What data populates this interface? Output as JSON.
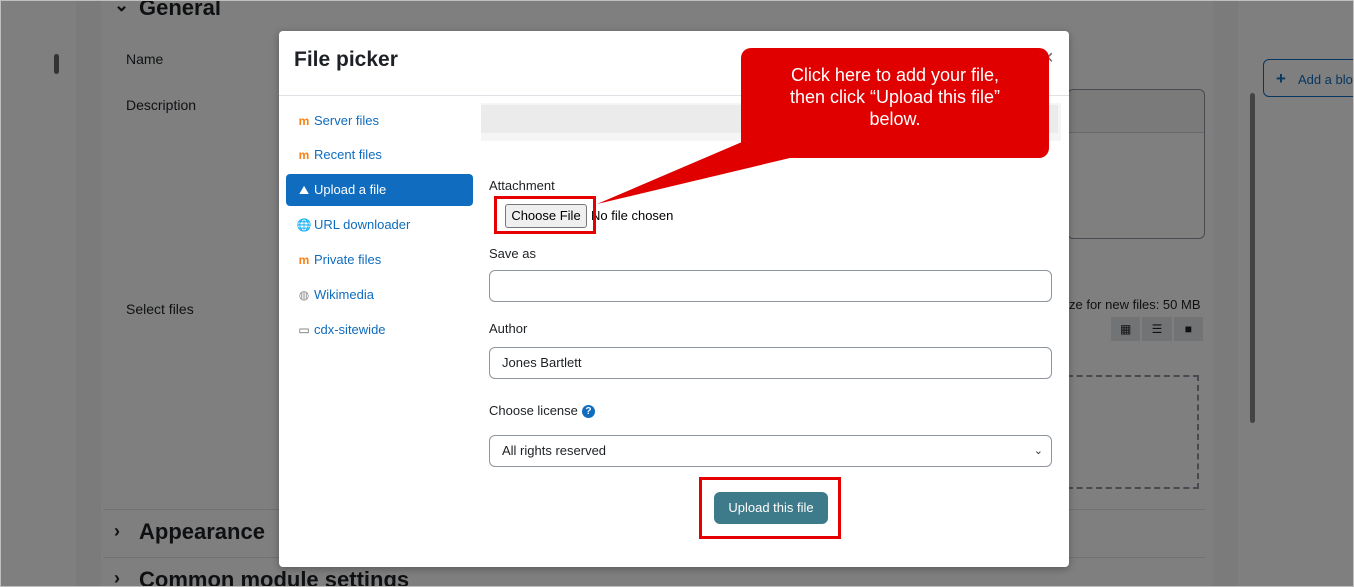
{
  "background": {
    "section_general": "General",
    "label_name": "Name",
    "label_description": "Description",
    "label_select_files": "Select files",
    "max_size_text": "ze for new files: 50 MB",
    "add_block_label": "Add a blo",
    "section_appearance": "Appearance",
    "section_common": "Common module settings"
  },
  "modal": {
    "title": "File picker",
    "close": "×",
    "repositories": [
      {
        "label": "Server files",
        "icon": "moodle-icon"
      },
      {
        "label": "Recent files",
        "icon": "moodle-icon"
      },
      {
        "label": "Upload a file",
        "icon": "upload-icon",
        "active": true
      },
      {
        "label": "URL downloader",
        "icon": "url-icon"
      },
      {
        "label": "Private files",
        "icon": "moodle-icon"
      },
      {
        "label": "Wikimedia",
        "icon": "wikimedia-icon"
      },
      {
        "label": "cdx-sitewide",
        "icon": "folder-icon"
      }
    ],
    "form": {
      "attachment_label": "Attachment",
      "choose_file_label": "Choose File",
      "no_file_text": "No file chosen",
      "save_as_label": "Save as",
      "save_as_value": "",
      "author_label": "Author",
      "author_value": "Jones Bartlett",
      "license_label": "Choose license",
      "license_value": "All rights reserved",
      "upload_button": "Upload this file"
    }
  },
  "callout": {
    "line1": "Click here to add your file,",
    "line2": "then click “Upload this file”",
    "line3": "below."
  },
  "colors": {
    "highlight": "#e60000",
    "callout": "#e00000",
    "active_repo": "#0f6cbf",
    "upload_button": "#3d7a8a"
  }
}
